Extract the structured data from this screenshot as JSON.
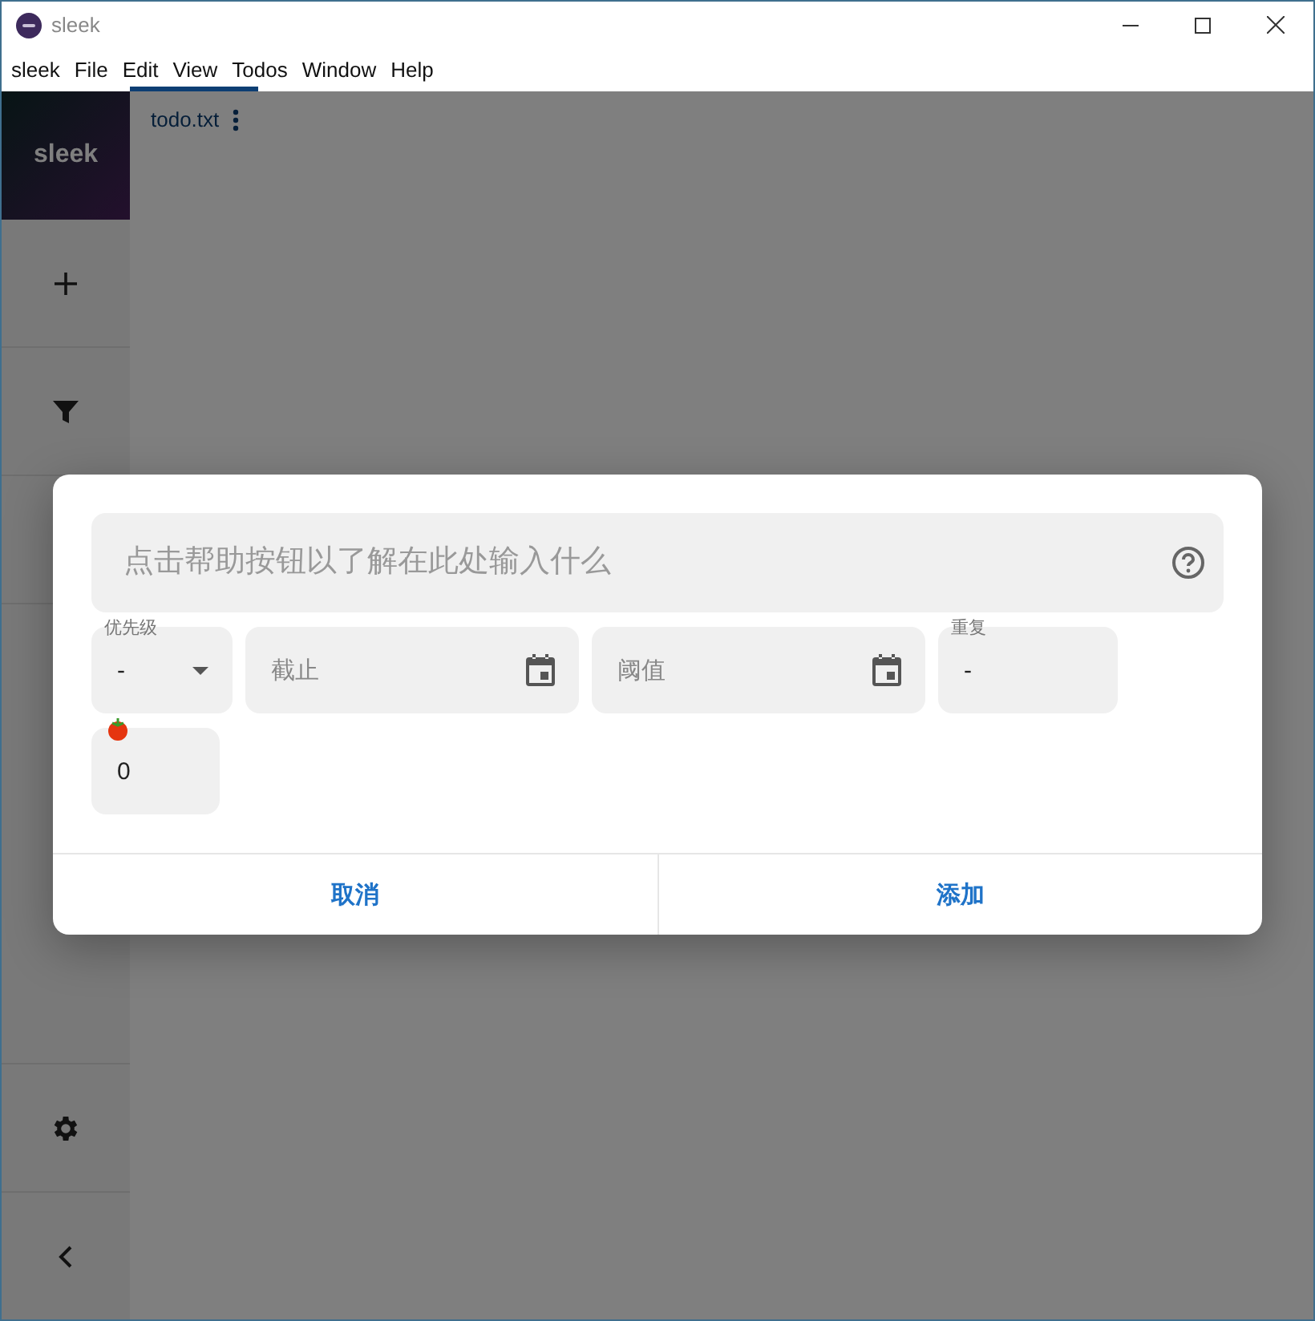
{
  "window": {
    "title": "sleek"
  },
  "menu": [
    "sleek",
    "File",
    "Edit",
    "View",
    "Todos",
    "Window",
    "Help"
  ],
  "sidebar": {
    "logo": "sleek",
    "items": [
      {
        "kind": "add"
      },
      {
        "kind": "filter"
      },
      {
        "kind": "blank"
      }
    ],
    "bottom": [
      {
        "kind": "settings"
      },
      {
        "kind": "collapse"
      }
    ]
  },
  "file_tab": {
    "label": "todo.txt",
    "selected": true
  },
  "dialog": {
    "input": {
      "placeholder": "点击帮助按钮以了解在此处输入什么"
    },
    "fields": [
      {
        "kind": "select",
        "label": "优先级",
        "value": "-"
      },
      {
        "kind": "date",
        "placeholder": "截止"
      },
      {
        "kind": "date",
        "placeholder": "阈值"
      },
      {
        "kind": "text",
        "label": "重复",
        "value": "-"
      },
      {
        "kind": "pomodoro",
        "value": "0"
      }
    ],
    "buttons": [
      "取消",
      "添加"
    ]
  }
}
